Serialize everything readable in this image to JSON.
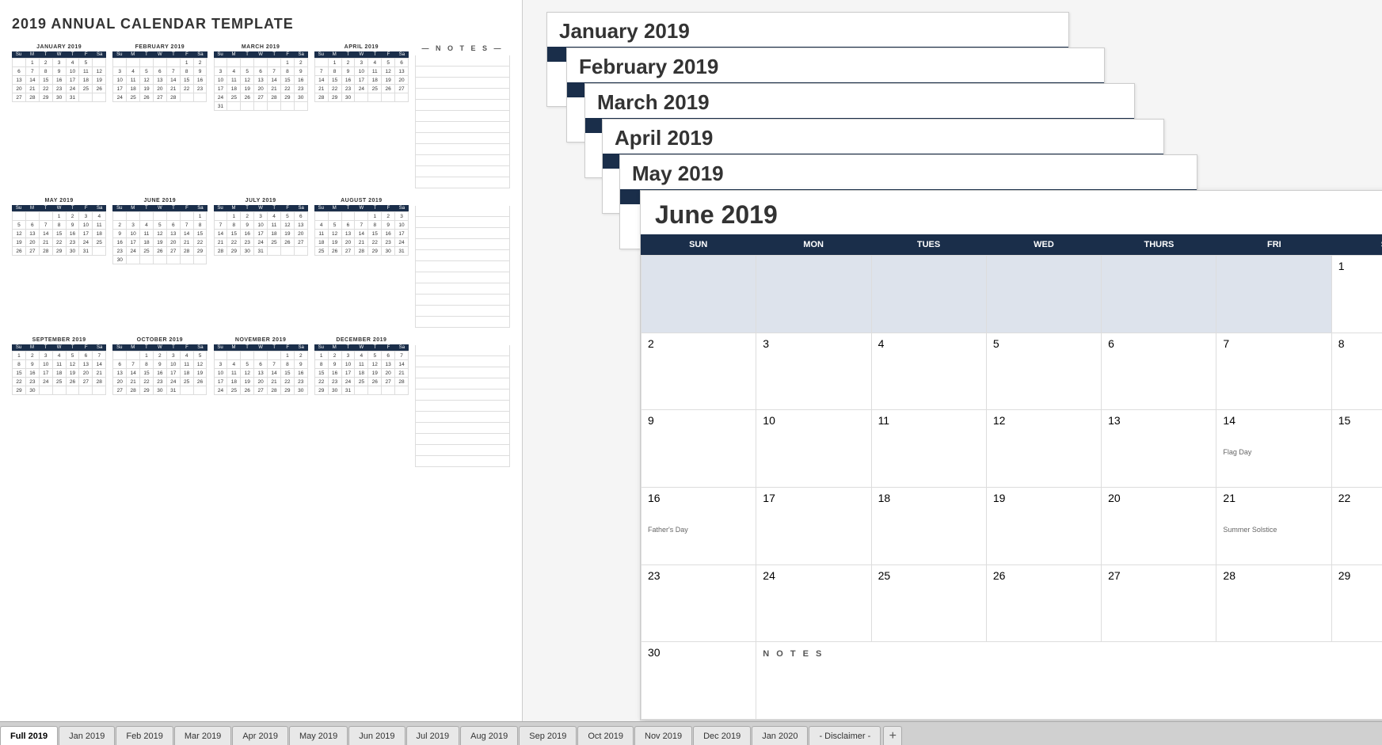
{
  "page": {
    "title": "2019 ANNUAL CALENDAR TEMPLATE"
  },
  "months": {
    "jan": {
      "name": "JANUARY 2019",
      "header": [
        "Su",
        "M",
        "T",
        "W",
        "T",
        "F",
        "Sa"
      ],
      "weeks": [
        [
          "",
          "1",
          "2",
          "3",
          "4",
          "5",
          ""
        ],
        [
          "6",
          "7",
          "8",
          "9",
          "10",
          "11",
          "12"
        ],
        [
          "13",
          "14",
          "15",
          "16",
          "17",
          "18",
          "19"
        ],
        [
          "20",
          "21",
          "22",
          "23",
          "24",
          "25",
          "26"
        ],
        [
          "27",
          "28",
          "29",
          "30",
          "31",
          "",
          ""
        ]
      ]
    },
    "feb": {
      "name": "FEBRUARY 2019",
      "header": [
        "Su",
        "M",
        "T",
        "W",
        "T",
        "F",
        "Sa"
      ],
      "weeks": [
        [
          "",
          "",
          "",
          "",
          "",
          "1",
          "2"
        ],
        [
          "3",
          "4",
          "5",
          "6",
          "7",
          "8",
          "9"
        ],
        [
          "10",
          "11",
          "12",
          "13",
          "14",
          "15",
          "16"
        ],
        [
          "17",
          "18",
          "19",
          "20",
          "21",
          "22",
          "23"
        ],
        [
          "24",
          "25",
          "26",
          "27",
          "28",
          "",
          ""
        ]
      ]
    },
    "mar": {
      "name": "MARCH 2019",
      "header": [
        "Su",
        "M",
        "T",
        "W",
        "T",
        "F",
        "Sa"
      ],
      "weeks": [
        [
          "",
          "",
          "",
          "",
          "",
          "1",
          "2"
        ],
        [
          "3",
          "4",
          "5",
          "6",
          "7",
          "8",
          "9"
        ],
        [
          "10",
          "11",
          "12",
          "13",
          "14",
          "15",
          "16"
        ],
        [
          "17",
          "18",
          "19",
          "20",
          "21",
          "22",
          "23"
        ],
        [
          "24",
          "25",
          "26",
          "27",
          "28",
          "29",
          "30"
        ],
        [
          "31",
          "",
          "",
          "",
          "",
          "",
          ""
        ]
      ]
    },
    "apr": {
      "name": "APRIL 2019",
      "header": [
        "Su",
        "M",
        "T",
        "W",
        "T",
        "F",
        "Sa"
      ],
      "weeks": [
        [
          "",
          "1",
          "2",
          "3",
          "4",
          "5",
          "6"
        ],
        [
          "7",
          "8",
          "9",
          "10",
          "11",
          "12",
          "13"
        ],
        [
          "14",
          "15",
          "16",
          "17",
          "18",
          "19",
          "20"
        ],
        [
          "21",
          "22",
          "23",
          "24",
          "25",
          "26",
          "27"
        ],
        [
          "28",
          "29",
          "30",
          "",
          "",
          "",
          ""
        ]
      ]
    },
    "may": {
      "name": "MAY 2019",
      "header": [
        "Su",
        "M",
        "T",
        "W",
        "T",
        "F",
        "Sa"
      ],
      "weeks": [
        [
          "",
          "",
          "",
          "1",
          "2",
          "3",
          "4"
        ],
        [
          "5",
          "6",
          "7",
          "8",
          "9",
          "10",
          "11"
        ],
        [
          "12",
          "13",
          "14",
          "15",
          "16",
          "17",
          "18"
        ],
        [
          "19",
          "20",
          "21",
          "22",
          "23",
          "24",
          "25"
        ],
        [
          "26",
          "27",
          "28",
          "29",
          "30",
          "31",
          ""
        ]
      ]
    },
    "jun": {
      "name": "JUNE 2019",
      "header": [
        "Su",
        "M",
        "T",
        "W",
        "T",
        "F",
        "Sa"
      ],
      "weeks": [
        [
          "",
          "",
          "",
          "",
          "",
          "",
          "1"
        ],
        [
          "2",
          "3",
          "4",
          "5",
          "6",
          "7",
          "8"
        ],
        [
          "9",
          "10",
          "11",
          "12",
          "13",
          "14",
          "15"
        ],
        [
          "16",
          "17",
          "18",
          "19",
          "20",
          "21",
          "22"
        ],
        [
          "23",
          "24",
          "25",
          "26",
          "27",
          "28",
          "29"
        ],
        [
          "30",
          "",
          "",
          "",
          "",
          "",
          ""
        ]
      ],
      "events": {
        "14": "Flag Day",
        "16": "Father's Day",
        "21": "Summer Solstice"
      }
    },
    "jul": {
      "name": "JULY 2019",
      "header": [
        "Su",
        "M",
        "T",
        "W",
        "T",
        "F",
        "Sa"
      ],
      "weeks": [
        [
          "",
          "1",
          "2",
          "3",
          "4",
          "5",
          "6"
        ],
        [
          "7",
          "8",
          "9",
          "10",
          "11",
          "12",
          "13"
        ],
        [
          "14",
          "15",
          "16",
          "17",
          "18",
          "19",
          "20"
        ],
        [
          "21",
          "22",
          "23",
          "24",
          "25",
          "26",
          "27"
        ],
        [
          "28",
          "29",
          "30",
          "31",
          "",
          "",
          ""
        ]
      ]
    },
    "aug": {
      "name": "AUGUST 2019",
      "header": [
        "Su",
        "M",
        "T",
        "W",
        "T",
        "F",
        "Sa"
      ],
      "weeks": [
        [
          "",
          "",
          "",
          "",
          "1",
          "2",
          "3"
        ],
        [
          "4",
          "5",
          "6",
          "7",
          "8",
          "9",
          "10"
        ],
        [
          "11",
          "12",
          "13",
          "14",
          "15",
          "16",
          "17"
        ],
        [
          "18",
          "19",
          "20",
          "21",
          "22",
          "23",
          "24"
        ],
        [
          "25",
          "26",
          "27",
          "28",
          "29",
          "30",
          "31"
        ]
      ]
    },
    "sep": {
      "name": "SEPTEMBER 2019",
      "header": [
        "Su",
        "M",
        "T",
        "W",
        "T",
        "F",
        "Sa"
      ],
      "weeks": [
        [
          "1",
          "2",
          "3",
          "4",
          "5",
          "6",
          "7"
        ],
        [
          "8",
          "9",
          "10",
          "11",
          "12",
          "13",
          "14"
        ],
        [
          "15",
          "16",
          "17",
          "18",
          "19",
          "20",
          "21"
        ],
        [
          "22",
          "23",
          "24",
          "25",
          "26",
          "27",
          "28"
        ],
        [
          "29",
          "30",
          "",
          "",
          "",
          "",
          ""
        ]
      ]
    },
    "oct": {
      "name": "OCTOBER 2019",
      "header": [
        "Su",
        "M",
        "T",
        "W",
        "T",
        "F",
        "Sa"
      ],
      "weeks": [
        [
          "",
          "",
          "1",
          "2",
          "3",
          "4",
          "5"
        ],
        [
          "6",
          "7",
          "8",
          "9",
          "10",
          "11",
          "12"
        ],
        [
          "13",
          "14",
          "15",
          "16",
          "17",
          "18",
          "19"
        ],
        [
          "20",
          "21",
          "22",
          "23",
          "24",
          "25",
          "26"
        ],
        [
          "27",
          "28",
          "29",
          "30",
          "31",
          "",
          ""
        ]
      ]
    },
    "nov": {
      "name": "NOVEMBER 2019",
      "header": [
        "Su",
        "M",
        "T",
        "W",
        "T",
        "F",
        "Sa"
      ],
      "weeks": [
        [
          "",
          "",
          "",
          "",
          "",
          "1",
          "2"
        ],
        [
          "3",
          "4",
          "5",
          "6",
          "7",
          "8",
          "9"
        ],
        [
          "10",
          "11",
          "12",
          "13",
          "14",
          "15",
          "16"
        ],
        [
          "17",
          "18",
          "19",
          "20",
          "21",
          "22",
          "23"
        ],
        [
          "24",
          "25",
          "26",
          "27",
          "28",
          "29",
          "30"
        ]
      ]
    },
    "dec": {
      "name": "DECEMBER 2019",
      "header": [
        "Su",
        "M",
        "T",
        "W",
        "T",
        "F",
        "Sa"
      ],
      "weeks": [
        [
          "1",
          "2",
          "3",
          "4",
          "5",
          "6",
          "7"
        ],
        [
          "8",
          "9",
          "10",
          "11",
          "12",
          "13",
          "14"
        ],
        [
          "15",
          "16",
          "17",
          "18",
          "19",
          "20",
          "21"
        ],
        [
          "22",
          "23",
          "24",
          "25",
          "26",
          "27",
          "28"
        ],
        [
          "29",
          "30",
          "31",
          "",
          "",
          "",
          ""
        ]
      ]
    }
  },
  "stacked": {
    "jan_title": "January 2019",
    "feb_title": "February 2019",
    "mar_title": "March 2019",
    "apr_title": "April 2019",
    "may_title": "May 2019",
    "june_title": "June 2019"
  },
  "june_full": {
    "title": "June 2019",
    "headers": [
      "SUN",
      "MON",
      "TUES",
      "WED",
      "THURS",
      "FRI",
      "SAT"
    ],
    "row1": [
      "",
      "",
      "",
      "",
      "",
      "",
      "1"
    ],
    "row2": [
      "2",
      "3",
      "4",
      "5",
      "6",
      "7",
      "8"
    ],
    "row3": [
      "9",
      "10",
      "11",
      "12",
      "13",
      "14",
      "15"
    ],
    "row4": [
      "16",
      "17",
      "18",
      "19",
      "20",
      "21",
      "22"
    ],
    "row5": [
      "23",
      "24",
      "25",
      "26",
      "27",
      "28",
      "29"
    ],
    "row6": [
      "30",
      "",
      "",
      "",
      "",
      "",
      ""
    ],
    "flag_day": "Flag Day",
    "fathers_day": "Father's Day",
    "summer_solstice": "Summer Solstice",
    "notes_label": "N O T E S"
  },
  "tabs": {
    "items": [
      {
        "label": "Full 2019",
        "active": true
      },
      {
        "label": "Jan 2019",
        "active": false
      },
      {
        "label": "Feb 2019",
        "active": false
      },
      {
        "label": "Mar 2019",
        "active": false
      },
      {
        "label": "Apr 2019",
        "active": false
      },
      {
        "label": "May 2019",
        "active": false
      },
      {
        "label": "Jun 2019",
        "active": false
      },
      {
        "label": "Jul 2019",
        "active": false
      },
      {
        "label": "Aug 2019",
        "active": false
      },
      {
        "label": "Sep 2019",
        "active": false
      },
      {
        "label": "Oct 2019",
        "active": false
      },
      {
        "label": "Nov 2019",
        "active": false
      },
      {
        "label": "Dec 2019",
        "active": false
      },
      {
        "label": "Jan 2020",
        "active": false
      },
      {
        "label": "- Disclaimer -",
        "active": false
      }
    ],
    "add": "+"
  },
  "notes_title": "— N O T E S —"
}
